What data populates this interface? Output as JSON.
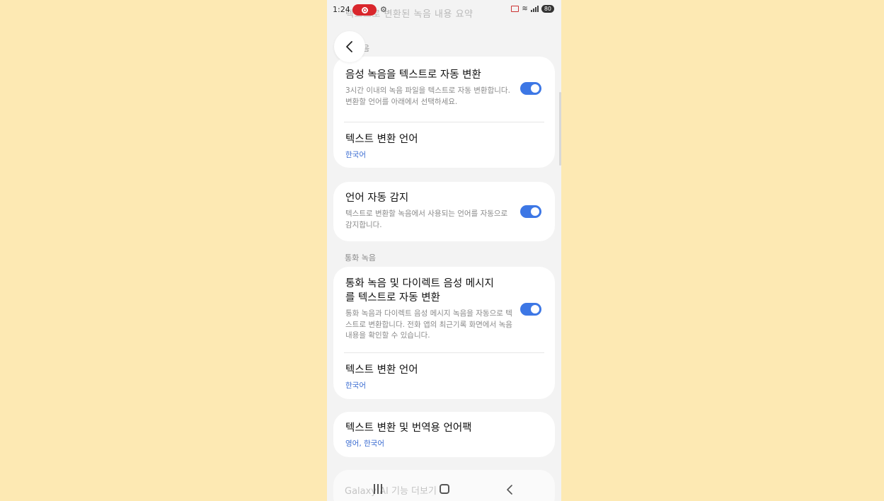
{
  "status_bar": {
    "time": "1:24",
    "battery": "80",
    "faded_title": "텍스트로 변환된 녹음 내용 요약"
  },
  "header": {
    "section_faded": "음"
  },
  "card1": {
    "auto_convert": {
      "title": "음성 녹음을 텍스트로 자동 변환",
      "desc": "3시간 이내의 녹음 파일을 텍스트로 자동 변환합니다. 변환할 언어를 아래에서 선택하세요.",
      "enabled": true
    },
    "language": {
      "title": "텍스트 변환 언어",
      "value": "한국어"
    }
  },
  "card2": {
    "auto_detect": {
      "title": "언어 자동 감지",
      "desc": "텍스트로 변환할 녹음에서 사용되는 언어를 자동으로 감지합니다.",
      "enabled": true
    }
  },
  "call_section": {
    "label": "통화 녹음",
    "auto_convert": {
      "title": "통화 녹음 및 다이렉트 음성 메시지를 텍스트로 자동 변환",
      "desc": "통화 녹음과 다이렉트 음성 메시지 녹음을 자동으로 텍스트로 변환합니다. 전화 앱의 최근기록 화면에서 녹음 내용을 확인할 수 있습니다.",
      "enabled": true
    },
    "language": {
      "title": "텍스트 변환 언어",
      "value": "한국어"
    }
  },
  "language_pack": {
    "title": "텍스트 변환 및 번역용 언어팩",
    "value": "영어, 한국어"
  },
  "bottom": {
    "faded_text": "Galaxy AI 기능 더보기"
  },
  "colors": {
    "background": "#fde9b3",
    "accent": "#3d77e5",
    "value_text": "#3a6cd1"
  },
  "icons": [
    "back-icon",
    "record-icon",
    "gear-icon",
    "cast-icon",
    "wifi-icon",
    "signal-icon",
    "battery-icon",
    "recent-apps-icon",
    "home-icon",
    "nav-back-icon"
  ]
}
